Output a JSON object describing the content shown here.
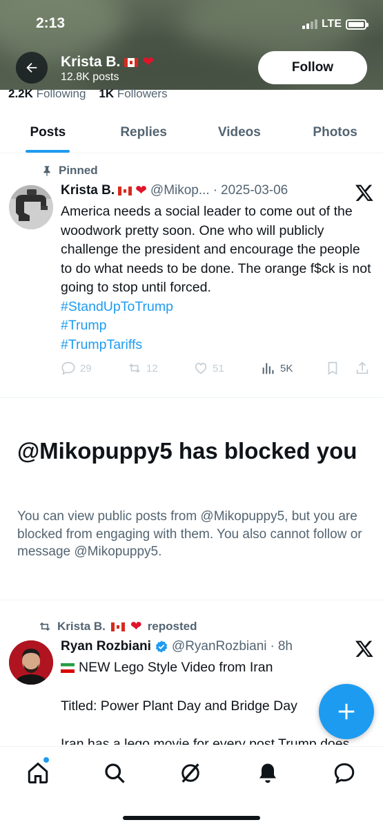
{
  "status_bar": {
    "time": "2:13",
    "network": "LTE"
  },
  "profile": {
    "name": "Krista B.",
    "posts_count": "12.8K posts",
    "follow_label": "Follow",
    "following_count": "2.2K",
    "following_label": "Following",
    "followers_count": "1K",
    "followers_label": "Followers"
  },
  "tabs": [
    {
      "label": "Posts",
      "active": true
    },
    {
      "label": "Replies",
      "active": false
    },
    {
      "label": "Videos",
      "active": false
    },
    {
      "label": "Photos",
      "active": false
    }
  ],
  "pinned_post": {
    "pinned_label": "Pinned",
    "author_name": "Krista B.",
    "handle": "@Mikop...",
    "date": "2025-03-06",
    "text": "America needs a social leader to come out of the woodwork pretty soon. One who will publicly challenge the president and encourage the people to do what needs to be done. The orange f$ck is not going to stop until forced.",
    "hashtags": [
      "#StandUpToTrump",
      "#Trump",
      "#TrumpTariffs"
    ],
    "stats": {
      "replies": "29",
      "reposts": "12",
      "likes": "51",
      "views": "5K"
    }
  },
  "blocked_notice": {
    "title": "@Mikopuppy5 has blocked you",
    "message": "You can view public posts from @Mikopuppy5, but you are blocked from engaging with them. You also cannot follow or message @Mikopuppy5."
  },
  "repost": {
    "reposter_name": "Krista B.",
    "reposted_label": "reposted",
    "author_name": "Ryan Rozbiani",
    "handle": "@RyanRozbiani",
    "time": "8h",
    "line1": "NEW Lego Style Video from Iran",
    "line2": "Titled: Power Plant Day and Bridge Day",
    "line3": "Iran has a lego movie for every post Trump does"
  },
  "colors": {
    "accent": "#1d9bf0",
    "text": "#0f1419",
    "secondary": "#536471"
  }
}
